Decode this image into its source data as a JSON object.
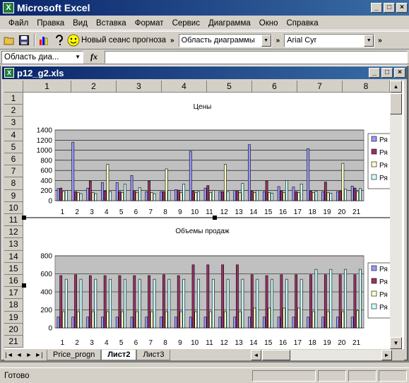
{
  "window": {
    "title": "Microsoft Excel",
    "app_icon": "excel-icon"
  },
  "menu": [
    "Файл",
    "Правка",
    "Вид",
    "Вставка",
    "Формат",
    "Сервис",
    "Диаграмма",
    "Окно",
    "Справка"
  ],
  "toolbar": {
    "smiley_label": "Новый сеанс прогноза",
    "object_select": "Область диаграммы",
    "font": "Arial Cyr"
  },
  "formula_bar": {
    "name_box": "Область диа...",
    "fx_label": "fx",
    "value": ""
  },
  "document": {
    "title": "p12_g2.xls"
  },
  "columns": [
    "1",
    "2",
    "3",
    "4",
    "5",
    "6",
    "7",
    "8"
  ],
  "rows": [
    "1",
    "2",
    "3",
    "4",
    "5",
    "6",
    "7",
    "8",
    "9",
    "10",
    "11",
    "12",
    "13",
    "14",
    "15",
    "16",
    "17",
    "18",
    "19",
    "20",
    "21"
  ],
  "sheet_tabs": [
    "Price_progn",
    "Лист2",
    "Лист3"
  ],
  "active_tab": "Лист2",
  "status": "Готово",
  "colors": {
    "s1": "#9999ff",
    "s2": "#993366",
    "s3": "#ffffcc",
    "s4": "#ccffff",
    "plot_bg": "#c0c0c0"
  },
  "chart_data": [
    {
      "type": "bar",
      "title": "Цены",
      "categories": [
        "1",
        "2",
        "3",
        "4",
        "5",
        "6",
        "7",
        "8",
        "9",
        "10",
        "11",
        "12",
        "13",
        "14",
        "15",
        "16",
        "17",
        "18",
        "19",
        "20",
        "21"
      ],
      "ylim": [
        0,
        1400
      ],
      "yticks": [
        0,
        200,
        400,
        600,
        800,
        1000,
        1200,
        1400
      ],
      "grid": true,
      "legend": "right",
      "series": [
        {
          "name": "Ря",
          "values": [
            240,
            1160,
            250,
            360,
            360,
            500,
            180,
            180,
            220,
            980,
            250,
            180,
            200,
            1110,
            180,
            280,
            270,
            1030,
            180,
            180,
            290
          ]
        },
        {
          "name": "Ря",
          "values": [
            250,
            180,
            390,
            190,
            180,
            200,
            390,
            180,
            210,
            190,
            300,
            180,
            200,
            190,
            390,
            190,
            180,
            190,
            370,
            190,
            250
          ]
        },
        {
          "name": "Ря",
          "values": [
            180,
            160,
            160,
            720,
            160,
            160,
            160,
            630,
            160,
            160,
            160,
            720,
            160,
            160,
            160,
            160,
            160,
            160,
            160,
            740,
            180
          ]
        },
        {
          "name": "Ря",
          "values": [
            200,
            140,
            140,
            180,
            330,
            260,
            140,
            200,
            330,
            180,
            200,
            180,
            340,
            200,
            150,
            400,
            330,
            190,
            150,
            230,
            240
          ]
        }
      ]
    },
    {
      "type": "bar",
      "title": "Объемы продаж",
      "categories": [
        "1",
        "2",
        "3",
        "4",
        "5",
        "6",
        "7",
        "8",
        "9",
        "10",
        "11",
        "12",
        "13",
        "14",
        "15",
        "16",
        "17",
        "18",
        "19",
        "20",
        "21"
      ],
      "ylim": [
        0,
        800
      ],
      "yticks": [
        0,
        200,
        400,
        600,
        800
      ],
      "grid": true,
      "legend": "right",
      "series": [
        {
          "name": "Ря",
          "values": [
            120,
            120,
            120,
            120,
            120,
            120,
            120,
            120,
            120,
            120,
            120,
            120,
            120,
            120,
            120,
            120,
            120,
            120,
            120,
            120,
            120
          ]
        },
        {
          "name": "Ря",
          "values": [
            580,
            590,
            580,
            580,
            580,
            580,
            580,
            590,
            580,
            700,
            700,
            700,
            700,
            590,
            580,
            590,
            590,
            590,
            590,
            590,
            590
          ]
        },
        {
          "name": "Ря",
          "values": [
            180,
            180,
            180,
            180,
            180,
            180,
            180,
            180,
            180,
            180,
            180,
            180,
            180,
            220,
            220,
            220,
            220,
            180,
            180,
            180,
            190
          ]
        },
        {
          "name": "Ря",
          "values": [
            540,
            540,
            540,
            540,
            540,
            540,
            540,
            540,
            540,
            540,
            540,
            540,
            540,
            540,
            540,
            540,
            540,
            650,
            650,
            650,
            650
          ]
        }
      ]
    }
  ]
}
